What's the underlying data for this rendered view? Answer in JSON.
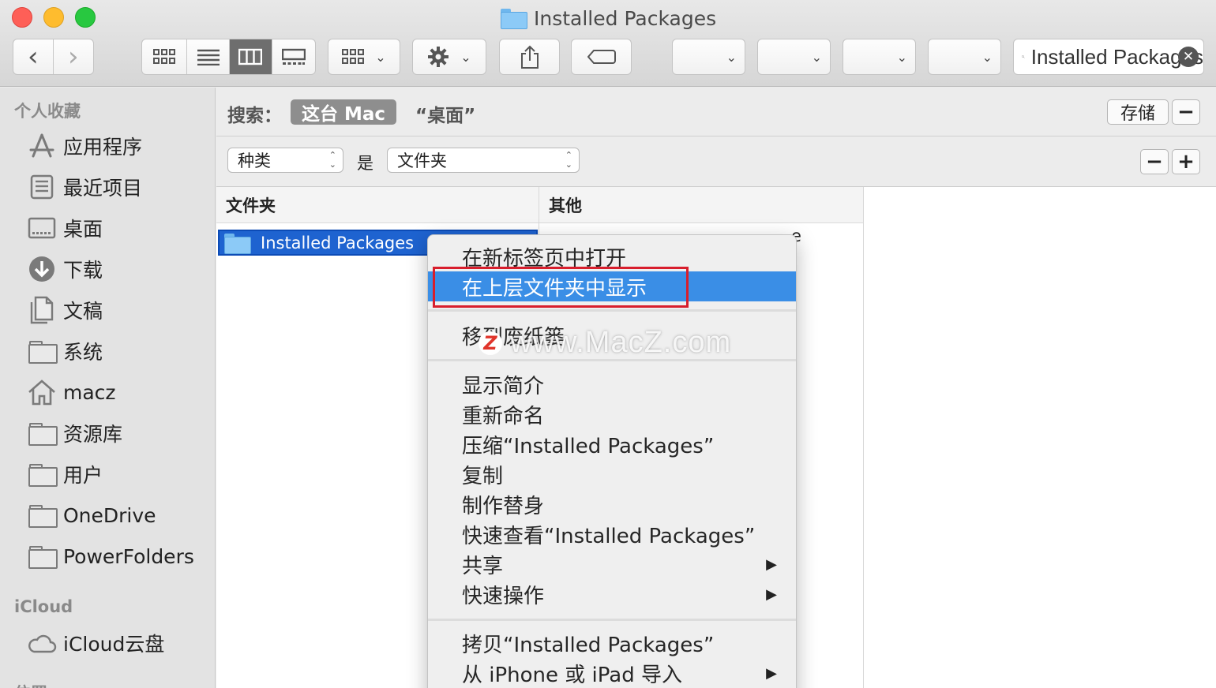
{
  "window": {
    "title": "Installed Packages"
  },
  "toolbar": {
    "back_glyph": "‹",
    "forward_glyph": "›",
    "search_value": "Installed Packages",
    "share_glyph": "⇧"
  },
  "sidebar": {
    "favorites_header": "个人收藏",
    "items": [
      {
        "label": "应用程序",
        "icon": "applications-icon"
      },
      {
        "label": "最近项目",
        "icon": "recents-icon"
      },
      {
        "label": "桌面",
        "icon": "desktop-icon"
      },
      {
        "label": "下载",
        "icon": "downloads-icon"
      },
      {
        "label": "文稿",
        "icon": "documents-icon"
      },
      {
        "label": "系统",
        "icon": "folder-icon"
      },
      {
        "label": "macz",
        "icon": "home-icon"
      },
      {
        "label": "资源库",
        "icon": "folder-icon"
      },
      {
        "label": "用户",
        "icon": "folder-icon"
      },
      {
        "label": "OneDrive",
        "icon": "folder-icon"
      },
      {
        "label": "PowerFolders",
        "icon": "folder-icon"
      }
    ],
    "icloud_header": "iCloud",
    "icloud_item": "iCloud云盘",
    "locations_header": "位置"
  },
  "search_scope": {
    "label": "搜索：",
    "active": "这台 Mac",
    "other": "“桌面”",
    "save": "存储",
    "minus": "−"
  },
  "criteria": {
    "kind": "种类",
    "is": "是",
    "value": "文件夹",
    "minus": "−",
    "plus": "+"
  },
  "columns": {
    "folders": "文件夹",
    "other": "其他"
  },
  "results": {
    "selected": "Installed Packages",
    "other_partial": "e"
  },
  "context_menu": {
    "items": [
      {
        "label": "在新标签页中打开"
      },
      {
        "label": "在上层文件夹中显示",
        "highlighted": true
      },
      {
        "label": "移到废纸篓"
      },
      {
        "label": "显示简介"
      },
      {
        "label": "重新命名"
      },
      {
        "label": "压缩“Installed Packages”"
      },
      {
        "label": "复制"
      },
      {
        "label": "制作替身"
      },
      {
        "label": "快速查看“Installed Packages”"
      },
      {
        "label": "共享",
        "submenu": true
      },
      {
        "label": "快速操作",
        "submenu": true
      },
      {
        "label": "拷贝“Installed Packages”"
      },
      {
        "label": "从 iPhone 或 iPad 导入",
        "submenu": true
      }
    ],
    "submenu_arrow": "▶"
  },
  "watermark": {
    "logo": "Z",
    "text": "www.MacZ.com"
  },
  "colors": {
    "highlight": "#3a8ee6",
    "selection": "#1e63d0",
    "annotation_box": "#d81e2c"
  }
}
